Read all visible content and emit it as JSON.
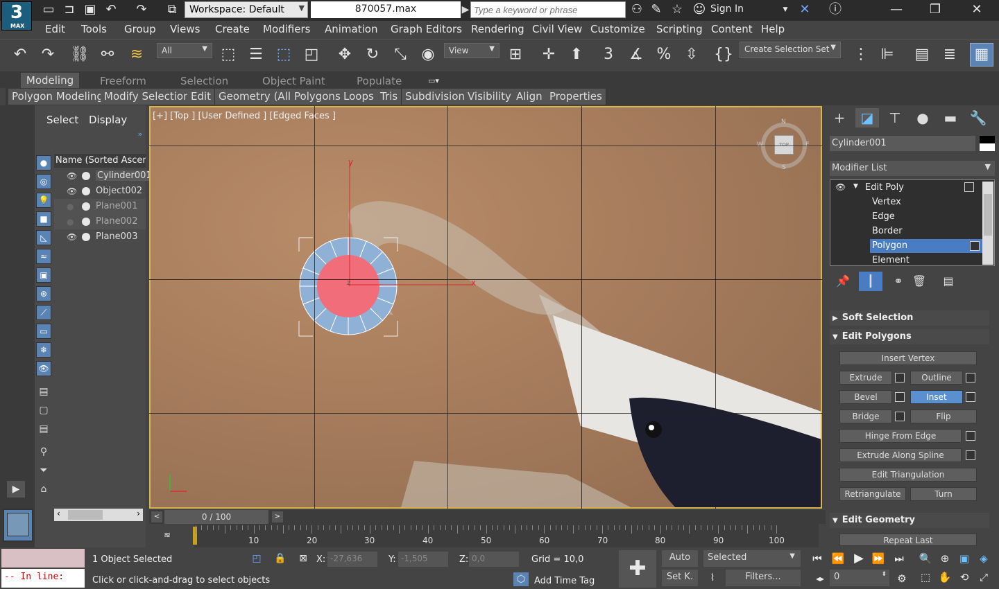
{
  "title_bar": {
    "app_logo_number": "3",
    "app_logo_text": "MAX",
    "workspace": "Workspace: Default",
    "filename": "870057.max",
    "search_placeholder": "Type a keyword or phrase",
    "sign_in": "Sign In"
  },
  "menu": [
    "Edit",
    "Tools",
    "Group",
    "Views",
    "Create",
    "Modifiers",
    "Animation",
    "Graph Editors",
    "Rendering",
    "Civil View",
    "Customize",
    "Scripting",
    "Content",
    "Help"
  ],
  "toolbar": {
    "filter_all": "All",
    "ref_coord": "View",
    "selection_set": "Create Selection Set"
  },
  "ribbon": {
    "tabs": [
      "Modeling",
      "Freeform",
      "Selection",
      "Object Paint",
      "Populate"
    ],
    "panels": [
      "Polygon Modeling",
      "Modify Selection",
      "Edit",
      "Geometry (All)",
      "Polygons",
      "Loops",
      "Tris",
      "Subdivision",
      "Visibility",
      "Align",
      "Properties"
    ]
  },
  "scene_explorer": {
    "tabs": [
      "Select",
      "Display"
    ],
    "column": "Name (Sorted Ascendi",
    "items": [
      "Cylinder001",
      "Object002",
      "Plane001",
      "Plane002",
      "Plane003"
    ]
  },
  "viewport": {
    "label": "[+] [Top ] [User Defined ] [Edged Faces ]",
    "viewcube_label": "TOP",
    "compass_n": "N",
    "compass_s": "S",
    "compass_e": "E",
    "compass_w": "W",
    "gizmo_x": "x",
    "gizmo_y": "y",
    "gizmo_z": "z"
  },
  "command_panel": {
    "object_name": "Cylinder001",
    "modifier_list": "Modifier List",
    "stack": [
      "Edit Poly",
      "Vertex",
      "Edge",
      "Border",
      "Polygon",
      "Element"
    ],
    "rollouts": {
      "soft_selection": "Soft Selection",
      "edit_polygons": "Edit Polygons",
      "edit_geometry": "Edit Geometry"
    },
    "buttons": {
      "insert_vertex": "Insert Vertex",
      "extrude": "Extrude",
      "outline": "Outline",
      "bevel": "Bevel",
      "inset": "Inset",
      "bridge": "Bridge",
      "flip": "Flip",
      "hinge": "Hinge From Edge",
      "extrude_spline": "Extrude Along Spline",
      "edit_tri": "Edit Triangulation",
      "retriangulate": "Retriangulate",
      "turn": "Turn",
      "repeat_last": "Repeat Last"
    }
  },
  "timeline": {
    "slider": "0 / 100",
    "labels": [
      "10",
      "20",
      "30",
      "40",
      "50",
      "60",
      "70",
      "80",
      "90",
      "100"
    ]
  },
  "status": {
    "maxscript": "-- In line:",
    "selected": "1 Object Selected",
    "prompt": "Click or click-and-drag to select objects",
    "x_label": "X:",
    "x_value": "-27,636",
    "y_label": "Y:",
    "y_value": "-1,505",
    "z_label": "Z:",
    "z_value": "0,0",
    "grid": "Grid = 10,0",
    "add_time_tag": "Add Time Tag",
    "auto": "Auto",
    "set_key": "Set K.",
    "selected_combo": "Selected",
    "filters": "Filters...",
    "frame": "0"
  }
}
